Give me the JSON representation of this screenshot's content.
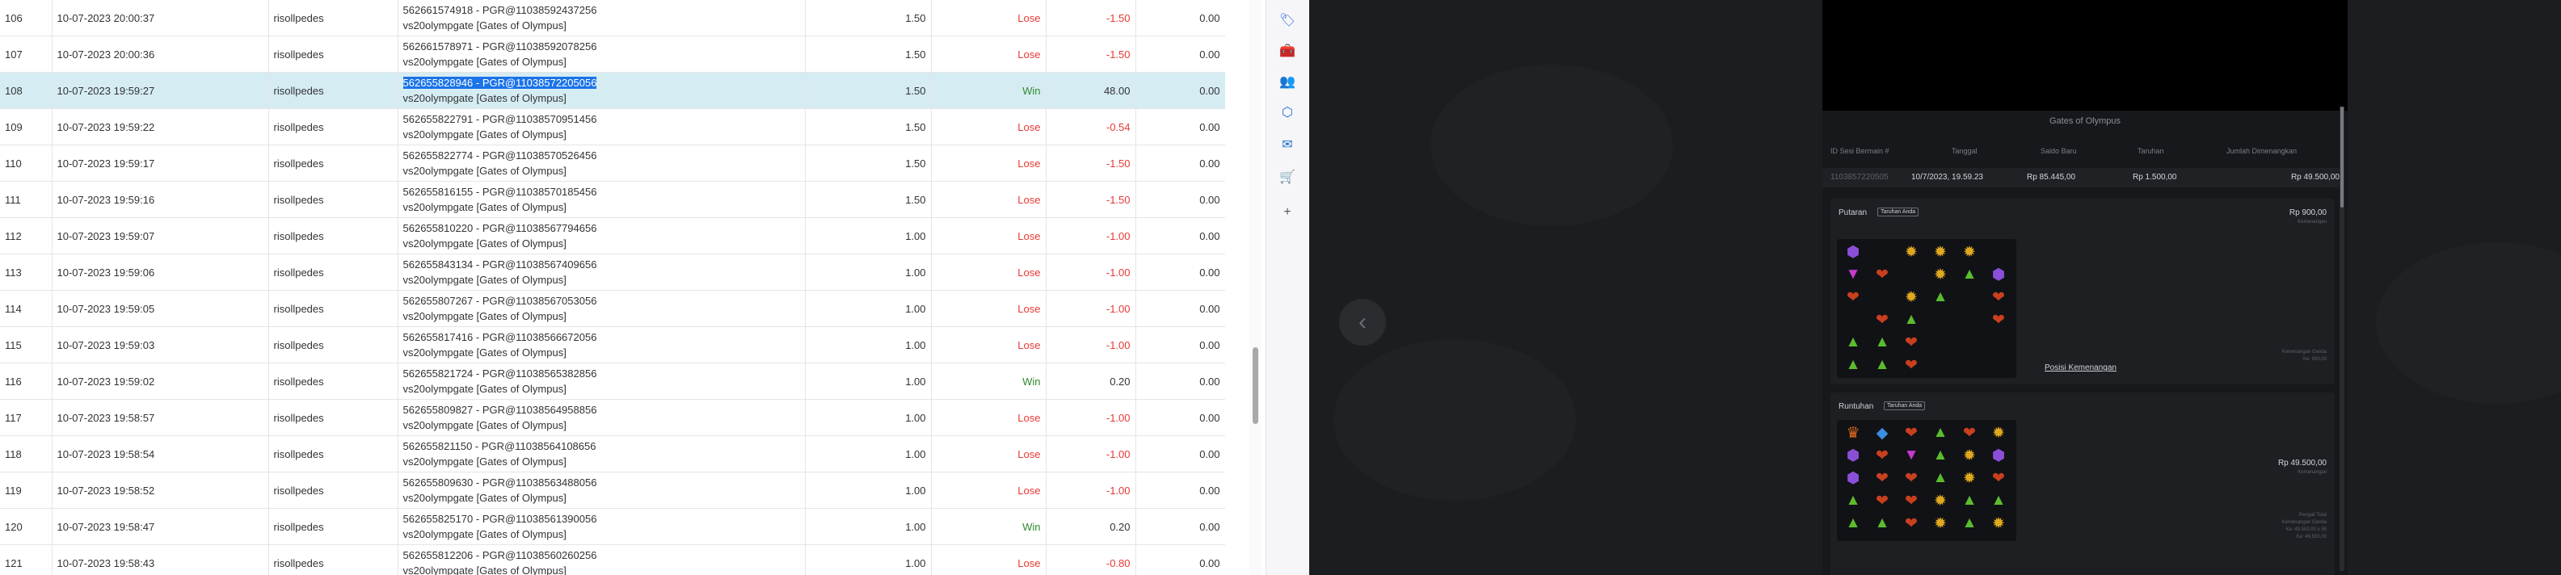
{
  "table": {
    "rows": [
      {
        "no": "106",
        "date": "10-07-2023 20:00:37",
        "user": "risollpedes",
        "bet_id": "562661574918 - PGR@11038592437256",
        "game": "vs20olympgate [Gates of Olympus]",
        "amount": "1.50",
        "result": "Lose",
        "winloss": "-1.50",
        "total": "0.00"
      },
      {
        "no": "107",
        "date": "10-07-2023 20:00:36",
        "user": "risollpedes",
        "bet_id": "562661578971 - PGR@11038592078256",
        "game": "vs20olympgate [Gates of Olympus]",
        "amount": "1.50",
        "result": "Lose",
        "winloss": "-1.50",
        "total": "0.00"
      },
      {
        "no": "108",
        "date": "10-07-2023 19:59:27",
        "user": "risollpedes",
        "bet_id": "562655828946 - PGR@11038572205056",
        "game": "vs20olympgate [Gates of Olympus]",
        "amount": "1.50",
        "result": "Win",
        "winloss": "48.00",
        "total": "0.00",
        "selected": true
      },
      {
        "no": "109",
        "date": "10-07-2023 19:59:22",
        "user": "risollpedes",
        "bet_id": "562655822791 - PGR@11038570951456",
        "game": "vs20olympgate [Gates of Olympus]",
        "amount": "1.50",
        "result": "Lose",
        "winloss": "-0.54",
        "total": "0.00"
      },
      {
        "no": "110",
        "date": "10-07-2023 19:59:17",
        "user": "risollpedes",
        "bet_id": "562655822774 - PGR@11038570526456",
        "game": "vs20olympgate [Gates of Olympus]",
        "amount": "1.50",
        "result": "Lose",
        "winloss": "-1.50",
        "total": "0.00"
      },
      {
        "no": "111",
        "date": "10-07-2023 19:59:16",
        "user": "risollpedes",
        "bet_id": "562655816155 - PGR@11038570185456",
        "game": "vs20olympgate [Gates of Olympus]",
        "amount": "1.50",
        "result": "Lose",
        "winloss": "-1.50",
        "total": "0.00"
      },
      {
        "no": "112",
        "date": "10-07-2023 19:59:07",
        "user": "risollpedes",
        "bet_id": "562655810220 - PGR@11038567794656",
        "game": "vs20olympgate [Gates of Olympus]",
        "amount": "1.00",
        "result": "Lose",
        "winloss": "-1.00",
        "total": "0.00"
      },
      {
        "no": "113",
        "date": "10-07-2023 19:59:06",
        "user": "risollpedes",
        "bet_id": "562655843134 - PGR@11038567409656",
        "game": "vs20olympgate [Gates of Olympus]",
        "amount": "1.00",
        "result": "Lose",
        "winloss": "-1.00",
        "total": "0.00"
      },
      {
        "no": "114",
        "date": "10-07-2023 19:59:05",
        "user": "risollpedes",
        "bet_id": "562655807267 - PGR@11038567053056",
        "game": "vs20olympgate [Gates of Olympus]",
        "amount": "1.00",
        "result": "Lose",
        "winloss": "-1.00",
        "total": "0.00"
      },
      {
        "no": "115",
        "date": "10-07-2023 19:59:03",
        "user": "risollpedes",
        "bet_id": "562655817416 - PGR@11038566672056",
        "game": "vs20olympgate [Gates of Olympus]",
        "amount": "1.00",
        "result": "Lose",
        "winloss": "-1.00",
        "total": "0.00"
      },
      {
        "no": "116",
        "date": "10-07-2023 19:59:02",
        "user": "risollpedes",
        "bet_id": "562655821724 - PGR@11038565382856",
        "game": "vs20olympgate [Gates of Olympus]",
        "amount": "1.00",
        "result": "Win",
        "winloss": "0.20",
        "total": "0.00"
      },
      {
        "no": "117",
        "date": "10-07-2023 19:58:57",
        "user": "risollpedes",
        "bet_id": "562655809827 - PGR@11038564958856",
        "game": "vs20olympgate [Gates of Olympus]",
        "amount": "1.00",
        "result": "Lose",
        "winloss": "-1.00",
        "total": "0.00"
      },
      {
        "no": "118",
        "date": "10-07-2023 19:58:54",
        "user": "risollpedes",
        "bet_id": "562655821150 - PGR@11038564108656",
        "game": "vs20olympgate [Gates of Olympus]",
        "amount": "1.00",
        "result": "Lose",
        "winloss": "-1.00",
        "total": "0.00"
      },
      {
        "no": "119",
        "date": "10-07-2023 19:58:52",
        "user": "risollpedes",
        "bet_id": "562655809630 - PGR@11038563488056",
        "game": "vs20olympgate [Gates of Olympus]",
        "amount": "1.00",
        "result": "Lose",
        "winloss": "-1.00",
        "total": "0.00"
      },
      {
        "no": "120",
        "date": "10-07-2023 19:58:47",
        "user": "risollpedes",
        "bet_id": "562655825170 - PGR@11038561390056",
        "game": "vs20olympgate [Gates of Olympus]",
        "amount": "1.00",
        "result": "Win",
        "winloss": "0.20",
        "total": "0.00"
      },
      {
        "no": "121",
        "date": "10-07-2023 19:58:43",
        "user": "risollpedes",
        "bet_id": "562655812206 - PGR@11038560260256",
        "game": "vs20olympgate [Gates of Olympus]",
        "amount": "1.00",
        "result": "Lose",
        "winloss": "-0.80",
        "total": "0.00"
      }
    ]
  },
  "toolbar": {
    "icons": [
      {
        "name": "tag-icon",
        "glyph": "🏷",
        "color": "#3b6fd8"
      },
      {
        "name": "toolbox-icon",
        "glyph": "🧰",
        "color": "#d9502a"
      },
      {
        "name": "people-icon",
        "glyph": "👥",
        "color": "#6a3fb5"
      },
      {
        "name": "office-icon",
        "glyph": "⬡",
        "color": "#2a6fd6"
      },
      {
        "name": "outlook-icon",
        "glyph": "✉",
        "color": "#1f6fc9"
      },
      {
        "name": "cart-icon",
        "glyph": "🛒",
        "color": "#2a7fd4"
      },
      {
        "name": "add-icon",
        "glyph": "+",
        "color": "#555555"
      }
    ]
  },
  "overlay": {
    "prev_icon": "‹",
    "panel": {
      "title": "Gates of Olympus",
      "headers": {
        "session_id": "ID Sesi Bermain #",
        "date": "Tanggal",
        "balance": "Saldo Baru",
        "bet": "Taruhan",
        "win": "Jumlah Dimenangkan"
      },
      "summary": {
        "session_id": "1103857220505",
        "date": "10/7/2023, 19.59.23",
        "balance": "Rp 85.445,00",
        "bet": "Rp 1.500,00",
        "win": "Rp 49.500,00"
      },
      "spin": {
        "label": "Putaran",
        "badge": "Taruhan Anda",
        "amount": "Rp 900,00",
        "amount_note": "Kemenangan",
        "info_line1": "Kemenangan Ganda",
        "info_line2": "Ke: 900,00",
        "win_position": "Posisi Kemenangan",
        "grid": [
          [
            "p",
            "",
            "y",
            "y",
            "y",
            ""
          ],
          [
            "m",
            "r",
            "",
            "y",
            "g",
            "p"
          ],
          [
            "r",
            "",
            "y",
            "g",
            "",
            "r"
          ],
          [
            "",
            "r",
            "g",
            "",
            "",
            "r"
          ],
          [
            "g",
            "g",
            "r",
            "",
            "",
            ""
          ],
          [
            "g",
            "g",
            "r",
            "",
            "",
            ""
          ]
        ]
      },
      "tumble": {
        "label": "Runtuhan",
        "badge": "Taruhan Anda",
        "amount": "Rp 49.500,00",
        "amount_note": "Kemenangan",
        "info_line1": "Pengali Total",
        "info_line2": "Kemenangan Ganda",
        "info_line3": "Ke: 49.500,00 x 55",
        "info_line4": "Ke: 49.500,00",
        "grid": [
          [
            "o",
            "b",
            "r",
            "g",
            "r",
            "y"
          ],
          [
            "p",
            "r",
            "m",
            "g",
            "y",
            "p"
          ],
          [
            "p",
            "r",
            "r",
            "g",
            "y",
            "r"
          ],
          [
            "g",
            "r",
            "r",
            "y",
            "g",
            "g"
          ],
          [
            "g",
            "g",
            "r",
            "y",
            "g",
            "y"
          ]
        ]
      }
    }
  },
  "colors": {
    "selected_row": "#d6ecf3",
    "win": "#2e8b2e",
    "lose": "#e53935",
    "overlay_bg": "#1c1d20"
  }
}
